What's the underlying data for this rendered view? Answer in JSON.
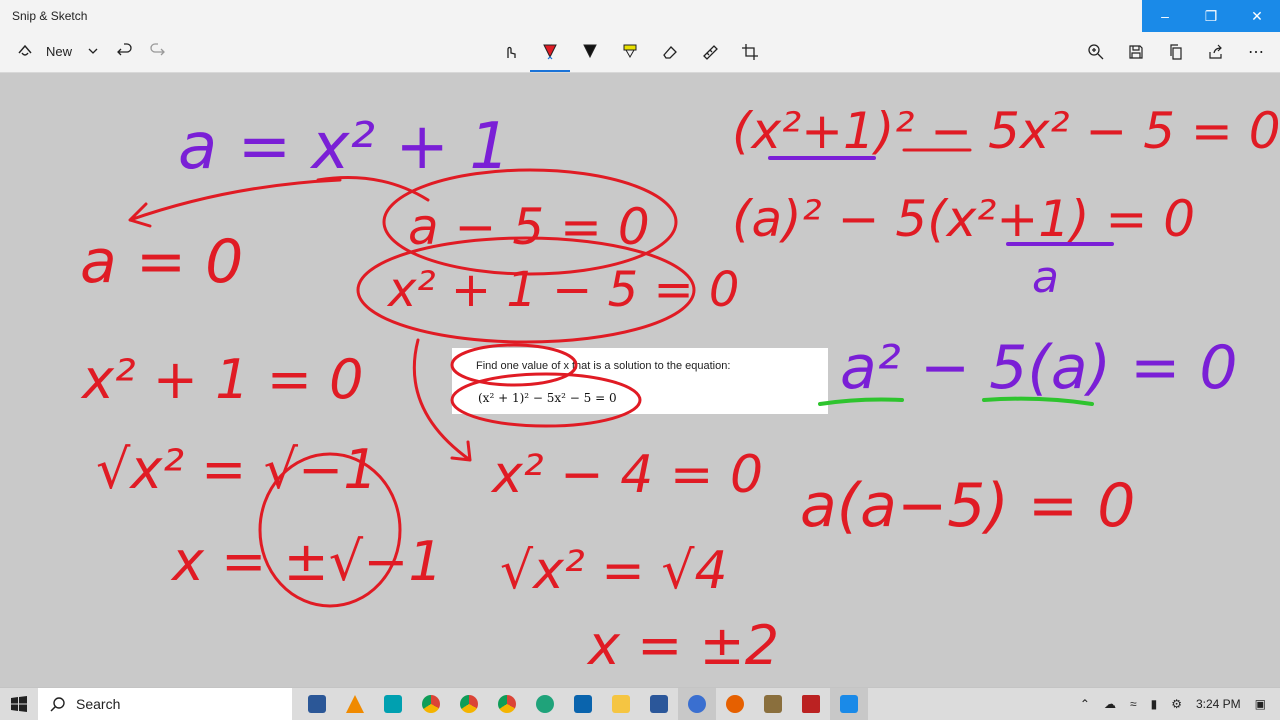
{
  "window": {
    "title": "Snip & Sketch",
    "controls": [
      "minimize-icon",
      "restore-icon",
      "close-icon"
    ]
  },
  "toolbar": {
    "new_label": "New",
    "tools": [
      "touch-writing",
      "ballpoint-pen",
      "pencil",
      "highlighter",
      "eraser",
      "ruler",
      "crop"
    ],
    "right_tools": [
      "zoom",
      "save",
      "copy",
      "share",
      "more"
    ]
  },
  "problem": {
    "question": "Find one value of x that is a solution to the equation:",
    "equation": "(x² + 1)² − 5x² − 5 = 0"
  },
  "ink_text": {
    "top_left": "a = x² + 1",
    "left_mid": "a = 0",
    "center_circle_1": "a − 5 = 0",
    "center_circle_2": "x² + 1 − 5 = 0",
    "top_right_1": "(x²+1)² − 5x² − 5 = 0",
    "top_right_2": "(a)² − 5(x²+1) = 0",
    "sub_a": "a",
    "right_mid": "a² − 5(a) = 0",
    "right_low": "a(a−5) = 0",
    "left_low_1": "x² + 1 = 0",
    "left_low_2": "√x² = √−1",
    "left_low_3": "x = ±√−1",
    "center_low_1": "x² − 4 = 0",
    "center_low_2": "√x² = √4",
    "center_low_3": "x = ±2"
  },
  "colors": {
    "ink_red": "#e01b24",
    "ink_purple": "#7a1fd6",
    "ink_green": "#2ec42e",
    "accent": "#1a8ae8"
  },
  "taskbar": {
    "search_placeholder": "Search",
    "time": "3:24 PM",
    "apps": [
      "task-view",
      "vlc",
      "sticky-notes",
      "chrome",
      "chrome-2",
      "chrome-3",
      "edge",
      "outlook",
      "file-explorer",
      "word",
      "settings",
      "firefox",
      "photos",
      "app-x",
      "snip-sketch"
    ]
  }
}
